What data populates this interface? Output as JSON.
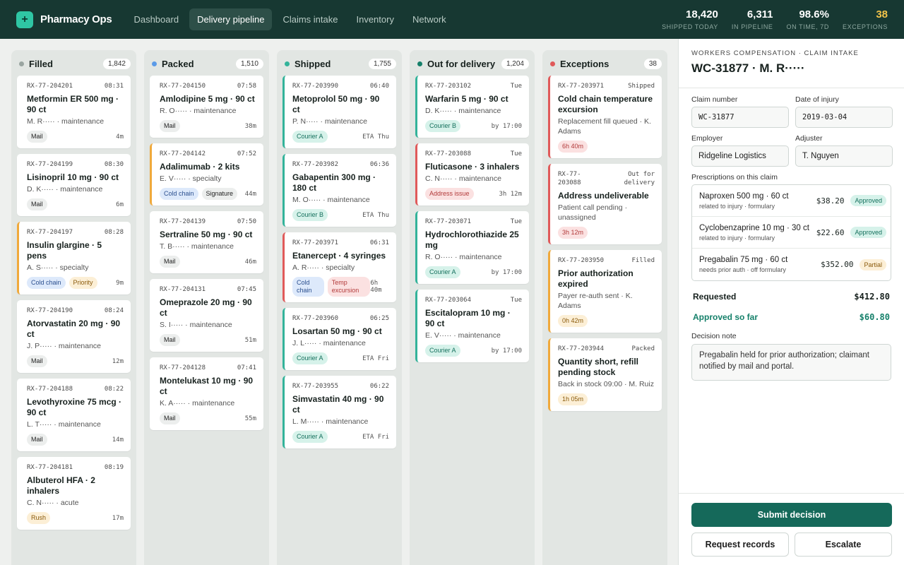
{
  "app": {
    "name": "Pharmacy Ops",
    "logo_icon": "plus-icon"
  },
  "nav": [
    "Dashboard",
    "Delivery pipeline",
    "Claims intake",
    "Inventory",
    "Network"
  ],
  "nav_active": 1,
  "stats": [
    {
      "value": "18,420",
      "label": "SHIPPED TODAY"
    },
    {
      "value": "6,311",
      "label": "IN PIPELINE"
    },
    {
      "value": "98.6%",
      "label": "ON TIME, 7D"
    },
    {
      "value": "38",
      "label": "EXCEPTIONS",
      "highlight": true
    }
  ],
  "columns": [
    {
      "title": "Filled",
      "count": "1,842",
      "color": "#9aa5a1",
      "cards": [
        {
          "rx": "RX-77-204201",
          "time": "08:31",
          "name": "Metformin ER 500 mg · 90 ct",
          "sub": "M. R····· · maintenance",
          "tags": [
            {
              "t": "Mail",
              "k": "plain"
            }
          ],
          "meta": "4m",
          "border": "none"
        },
        {
          "rx": "RX-77-204199",
          "time": "08:30",
          "name": "Lisinopril 10 mg · 90 ct",
          "sub": "D. K····· · maintenance",
          "tags": [
            {
              "t": "Mail",
              "k": "plain"
            }
          ],
          "meta": "6m",
          "border": "none"
        },
        {
          "rx": "RX-77-204197",
          "time": "08:28",
          "name": "Insulin glargine · 5 pens",
          "sub": "A. S····· · specialty",
          "tags": [
            {
              "t": "Cold chain",
              "k": "cold"
            },
            {
              "t": "Priority",
              "k": "prio"
            }
          ],
          "meta": "9m",
          "border": "amber"
        },
        {
          "rx": "RX-77-204190",
          "time": "08:24",
          "name": "Atorvastatin 20 mg · 90 ct",
          "sub": "J. P····· · maintenance",
          "tags": [
            {
              "t": "Mail",
              "k": "plain"
            }
          ],
          "meta": "12m",
          "border": "none"
        },
        {
          "rx": "RX-77-204188",
          "time": "08:22",
          "name": "Levothyroxine 75 mcg · 90 ct",
          "sub": "L. T····· · maintenance",
          "tags": [
            {
              "t": "Mail",
              "k": "plain"
            }
          ],
          "meta": "14m",
          "border": "none"
        },
        {
          "rx": "RX-77-204181",
          "time": "08:19",
          "name": "Albuterol HFA · 2 inhalers",
          "sub": "C. N····· · acute",
          "tags": [
            {
              "t": "Rush",
              "k": "rush"
            }
          ],
          "meta": "17m",
          "border": "none"
        }
      ]
    },
    {
      "title": "Packed",
      "count": "1,510",
      "color": "#5b9be8",
      "cards": [
        {
          "rx": "RX-77-204150",
          "time": "07:58",
          "name": "Amlodipine 5 mg · 90 ct",
          "sub": "R. O····· · maintenance",
          "tags": [
            {
              "t": "Mail",
              "k": "plain"
            }
          ],
          "meta": "38m",
          "border": "none"
        },
        {
          "rx": "RX-77-204142",
          "time": "07:52",
          "name": "Adalimumab · 2 kits",
          "sub": "E. V····· · specialty",
          "tags": [
            {
              "t": "Cold chain",
              "k": "cold"
            },
            {
              "t": "Signature",
              "k": "plain"
            }
          ],
          "meta": "44m",
          "border": "amber"
        },
        {
          "rx": "RX-77-204139",
          "time": "07:50",
          "name": "Sertraline 50 mg · 90 ct",
          "sub": "T. B····· · maintenance",
          "tags": [
            {
              "t": "Mail",
              "k": "plain"
            }
          ],
          "meta": "46m",
          "border": "none"
        },
        {
          "rx": "RX-77-204131",
          "time": "07:45",
          "name": "Omeprazole 20 mg · 90 ct",
          "sub": "S. I····· · maintenance",
          "tags": [
            {
              "t": "Mail",
              "k": "plain"
            }
          ],
          "meta": "51m",
          "border": "none"
        },
        {
          "rx": "RX-77-204128",
          "time": "07:41",
          "name": "Montelukast 10 mg · 90 ct",
          "sub": "K. A····· · maintenance",
          "tags": [
            {
              "t": "Mail",
              "k": "plain"
            }
          ],
          "meta": "55m",
          "border": "none"
        }
      ]
    },
    {
      "title": "Shipped",
      "count": "1,755",
      "color": "#33b39a",
      "cards": [
        {
          "rx": "RX-77-203990",
          "time": "06:40",
          "name": "Metoprolol 50 mg · 90 ct",
          "sub": "P. N····· · maintenance",
          "tags": [
            {
              "t": "Courier A",
              "k": "courier"
            }
          ],
          "meta": "ETA Thu",
          "border": "teal"
        },
        {
          "rx": "RX-77-203982",
          "time": "06:36",
          "name": "Gabapentin 300 mg · 180 ct",
          "sub": "M. O····· · maintenance",
          "tags": [
            {
              "t": "Courier B",
              "k": "courier"
            }
          ],
          "meta": "ETA Thu",
          "border": "teal"
        },
        {
          "rx": "RX-77-203971",
          "time": "06:31",
          "name": "Etanercept · 4 syringes",
          "sub": "A. R····· · specialty",
          "tags": [
            {
              "t": "Cold chain",
              "k": "cold"
            },
            {
              "t": "Temp excursion",
              "k": "red"
            }
          ],
          "meta": "6h 40m",
          "border": "red"
        },
        {
          "rx": "RX-77-203960",
          "time": "06:25",
          "name": "Losartan 50 mg · 90 ct",
          "sub": "J. L····· · maintenance",
          "tags": [
            {
              "t": "Courier A",
              "k": "courier"
            }
          ],
          "meta": "ETA Fri",
          "border": "teal"
        },
        {
          "rx": "RX-77-203955",
          "time": "06:22",
          "name": "Simvastatin 40 mg · 90 ct",
          "sub": "L. M····· · maintenance",
          "tags": [
            {
              "t": "Courier A",
              "k": "courier"
            }
          ],
          "meta": "ETA Fri",
          "border": "teal"
        }
      ]
    },
    {
      "title": "Out for delivery",
      "count": "1,204",
      "color": "#15806a",
      "cards": [
        {
          "rx": "RX-77-203102",
          "time": "Tue",
          "name": "Warfarin 5 mg · 90 ct",
          "sub": "D. K····· · maintenance",
          "tags": [
            {
              "t": "Courier B",
              "k": "courier"
            }
          ],
          "meta": "by 17:00",
          "border": "teal"
        },
        {
          "rx": "RX-77-203088",
          "time": "Tue",
          "name": "Fluticasone · 3 inhalers",
          "sub": "C. N····· · maintenance",
          "tags": [
            {
              "t": "Address issue",
              "k": "red"
            }
          ],
          "meta": "3h 12m",
          "border": "red"
        },
        {
          "rx": "RX-77-203071",
          "time": "Tue",
          "name": "Hydrochlorothiazide 25 mg",
          "sub": "R. O····· · maintenance",
          "tags": [
            {
              "t": "Courier A",
              "k": "courier"
            }
          ],
          "meta": "by 17:00",
          "border": "teal"
        },
        {
          "rx": "RX-77-203064",
          "time": "Tue",
          "name": "Escitalopram 10 mg · 90 ct",
          "sub": "E. V····· · maintenance",
          "tags": [
            {
              "t": "Courier A",
              "k": "courier"
            }
          ],
          "meta": "by 17:00",
          "border": "teal"
        }
      ]
    },
    {
      "title": "Exceptions",
      "count": "38",
      "color": "#e05a5a",
      "cards": [
        {
          "rx": "RX-77-203971",
          "time": "Shipped",
          "name": "Cold chain temperature excursion",
          "sub": "Replacement fill queued · K. Adams",
          "tags": [
            {
              "t": "6h 40m",
              "k": "red"
            }
          ],
          "meta": "",
          "border": "red"
        },
        {
          "rx": "RX-77-203088",
          "time": "Out for delivery",
          "name": "Address undeliverable",
          "sub": "Patient call pending · unassigned",
          "tags": [
            {
              "t": "3h 12m",
              "k": "red"
            }
          ],
          "meta": "",
          "border": "red"
        },
        {
          "rx": "RX-77-203950",
          "time": "Filled",
          "name": "Prior authorization expired",
          "sub": "Payer re-auth sent · K. Adams",
          "tags": [
            {
              "t": "0h 42m",
              "k": "amber"
            }
          ],
          "meta": "",
          "border": "amber"
        },
        {
          "rx": "RX-77-203944",
          "time": "Packed",
          "name": "Quantity short, refill pending stock",
          "sub": "Back in stock 09:00 · M. Ruiz",
          "tags": [
            {
              "t": "1h 05m",
              "k": "amber"
            }
          ],
          "meta": "",
          "border": "amber"
        }
      ]
    }
  ],
  "panel": {
    "eyebrow": "WORKERS COMPENSATION · CLAIM INTAKE",
    "title": "WC-31877 · M. R·····",
    "claim_number_label": "Claim number",
    "claim_number": "WC-31877",
    "date_label": "Date of injury",
    "date": "2019-03-04",
    "employer_label": "Employer",
    "employer": "Ridgeline Logistics",
    "adjuster_label": "Adjuster",
    "adjuster": "T. Nguyen",
    "rx_label": "Prescriptions on this claim",
    "prescriptions": [
      {
        "name": "Naproxen 500 mg · 60 ct",
        "note": "related to injury · formulary",
        "price": "$38.20",
        "status": "Approved",
        "kind": "ok"
      },
      {
        "name": "Cyclobenzaprine 10 mg · 30 ct",
        "note": "related to injury · formulary",
        "price": "$22.60",
        "status": "Approved",
        "kind": "ok"
      },
      {
        "name": "Pregabalin 75 mg · 60 ct",
        "note": "needs prior auth · off formulary",
        "price": "$352.00",
        "status": "Partial",
        "kind": "part"
      }
    ],
    "requested_label": "Requested",
    "requested": "$412.80",
    "approved_label": "Approved so far",
    "approved": "$60.80",
    "note_label": "Decision note",
    "note": "Pregabalin held for prior authorization; claimant notified by mail and portal.",
    "submit": "Submit decision",
    "request_records": "Request records",
    "escalate": "Escalate"
  }
}
